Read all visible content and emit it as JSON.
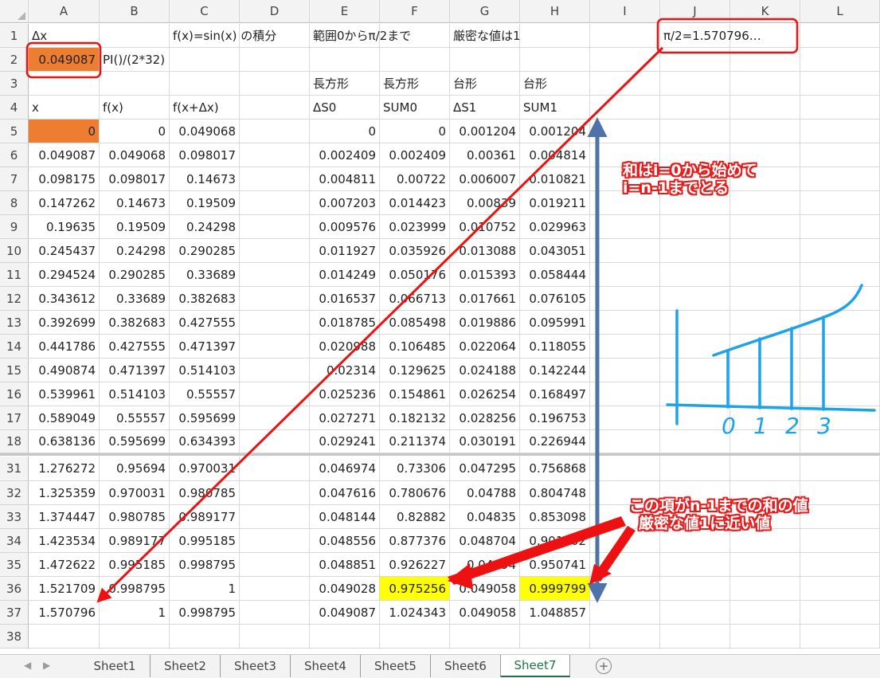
{
  "columns": [
    "A",
    "B",
    "C",
    "D",
    "E",
    "F",
    "G",
    "H",
    "I",
    "J",
    "K",
    "L"
  ],
  "rows": [
    {
      "num": "1",
      "cells": {
        "A": "Δx",
        "C": "f(x)=sin(x) の積分",
        "E": "範囲0からπ/2まで",
        "G": "厳密な値は1",
        "J": "π/2=1.570796…"
      }
    },
    {
      "num": "2",
      "cells": {
        "A": "0.049087",
        "B": "PI()/(2*32)"
      }
    },
    {
      "num": "3",
      "cells": {
        "E": "長方形",
        "F": "長方形",
        "G": "台形",
        "H": "台形"
      }
    },
    {
      "num": "4",
      "cells": {
        "A": "x",
        "B": "f(x)",
        "C": "f(x+Δx)",
        "E": "ΔS0",
        "F": "SUM0",
        "G": "ΔS1",
        "H": "SUM1"
      }
    },
    {
      "num": "5",
      "cells": {
        "A": "0",
        "B": "0",
        "C": "0.049068",
        "E": "0",
        "F": "0",
        "G": "0.001204",
        "H": "0.001204"
      }
    },
    {
      "num": "6",
      "cells": {
        "A": "0.049087",
        "B": "0.049068",
        "C": "0.098017",
        "E": "0.002409",
        "F": "0.002409",
        "G": "0.00361",
        "H": "0.004814"
      }
    },
    {
      "num": "7",
      "cells": {
        "A": "0.098175",
        "B": "0.098017",
        "C": "0.14673",
        "E": "0.004811",
        "F": "0.00722",
        "G": "0.006007",
        "H": "0.010821"
      }
    },
    {
      "num": "8",
      "cells": {
        "A": "0.147262",
        "B": "0.14673",
        "C": "0.19509",
        "E": "0.007203",
        "F": "0.014423",
        "G": "0.00839",
        "H": "0.019211"
      }
    },
    {
      "num": "9",
      "cells": {
        "A": "0.19635",
        "B": "0.19509",
        "C": "0.24298",
        "E": "0.009576",
        "F": "0.023999",
        "G": "0.010752",
        "H": "0.029963"
      }
    },
    {
      "num": "10",
      "cells": {
        "A": "0.245437",
        "B": "0.24298",
        "C": "0.290285",
        "E": "0.011927",
        "F": "0.035926",
        "G": "0.013088",
        "H": "0.043051"
      }
    },
    {
      "num": "11",
      "cells": {
        "A": "0.294524",
        "B": "0.290285",
        "C": "0.33689",
        "E": "0.014249",
        "F": "0.050176",
        "G": "0.015393",
        "H": "0.058444"
      }
    },
    {
      "num": "12",
      "cells": {
        "A": "0.343612",
        "B": "0.33689",
        "C": "0.382683",
        "E": "0.016537",
        "F": "0.066713",
        "G": "0.017661",
        "H": "0.076105"
      }
    },
    {
      "num": "13",
      "cells": {
        "A": "0.392699",
        "B": "0.382683",
        "C": "0.427555",
        "E": "0.018785",
        "F": "0.085498",
        "G": "0.019886",
        "H": "0.095991"
      }
    },
    {
      "num": "14",
      "cells": {
        "A": "0.441786",
        "B": "0.427555",
        "C": "0.471397",
        "E": "0.020988",
        "F": "0.106485",
        "G": "0.022064",
        "H": "0.118055"
      }
    },
    {
      "num": "15",
      "cells": {
        "A": "0.490874",
        "B": "0.471397",
        "C": "0.514103",
        "E": "0.02314",
        "F": "0.129625",
        "G": "0.024188",
        "H": "0.142244"
      }
    },
    {
      "num": "16",
      "cells": {
        "A": "0.539961",
        "B": "0.514103",
        "C": "0.55557",
        "E": "0.025236",
        "F": "0.154861",
        "G": "0.026254",
        "H": "0.168497"
      }
    },
    {
      "num": "17",
      "cells": {
        "A": "0.589049",
        "B": "0.55557",
        "C": "0.595699",
        "E": "0.027271",
        "F": "0.182132",
        "G": "0.028256",
        "H": "0.196753"
      }
    },
    {
      "num": "18",
      "cells": {
        "A": "0.638136",
        "B": "0.595699",
        "C": "0.634393",
        "E": "0.029241",
        "F": "0.211374",
        "G": "0.030191",
        "H": "0.226944"
      }
    },
    {
      "num": "31",
      "cells": {
        "A": "1.276272",
        "B": "0.95694",
        "C": "0.970031",
        "E": "0.046974",
        "F": "0.73306",
        "G": "0.047295",
        "H": "0.756868"
      }
    },
    {
      "num": "32",
      "cells": {
        "A": "1.325359",
        "B": "0.970031",
        "C": "0.980785",
        "E": "0.047616",
        "F": "0.780676",
        "G": "0.04788",
        "H": "0.804748"
      }
    },
    {
      "num": "33",
      "cells": {
        "A": "1.374447",
        "B": "0.980785",
        "C": "0.989177",
        "E": "0.048144",
        "F": "0.82882",
        "G": "0.04835",
        "H": "0.853098"
      }
    },
    {
      "num": "34",
      "cells": {
        "A": "1.423534",
        "B": "0.989177",
        "C": "0.995185",
        "E": "0.048556",
        "F": "0.877376",
        "G": "0.048704",
        "H": "0.901802"
      }
    },
    {
      "num": "35",
      "cells": {
        "A": "1.472622",
        "B": "0.995185",
        "C": "0.998795",
        "E": "0.048851",
        "F": "0.926227",
        "G": "0.04894",
        "H": "0.950741"
      }
    },
    {
      "num": "36",
      "cells": {
        "A": "1.521709",
        "B": "0.998795",
        "C": "1",
        "E": "0.049028",
        "F": "0.975256",
        "G": "0.049058",
        "H": "0.999799"
      }
    },
    {
      "num": "37",
      "cells": {
        "A": "1.570796",
        "B": "1",
        "C": "0.998795",
        "E": "0.049087",
        "F": "1.024343",
        "G": "0.049058",
        "H": "1.048857"
      }
    },
    {
      "num": "38",
      "cells": {}
    }
  ],
  "highlights": {
    "orange": [
      "A2",
      "A5"
    ],
    "yellow": [
      "F36",
      "H36"
    ]
  },
  "annotations": {
    "note1": [
      "和はi=0から始めて",
      "i=n-1までとる"
    ],
    "note2": [
      "この項がn-1までの和の値",
      "厳密な値1に近い値"
    ],
    "sketch_labels": [
      "0",
      "1",
      "2",
      "3"
    ]
  },
  "colors": {
    "arrow_red": "#ee1111",
    "arrow_blue": "#4f73a8",
    "sketch_blue": "#1fa2e6",
    "highlight_orange": "#ed7d31",
    "highlight_yellow": "#ffff00",
    "active_tab": "#217346"
  },
  "sheet_tabs": [
    "Sheet1",
    "Sheet2",
    "Sheet3",
    "Sheet4",
    "Sheet5",
    "Sheet6",
    "Sheet7"
  ],
  "active_tab": "Sheet7",
  "tab_nav_icons": [
    "tab-scroll-left-icon",
    "tab-scroll-right-icon",
    "add-sheet-icon"
  ]
}
